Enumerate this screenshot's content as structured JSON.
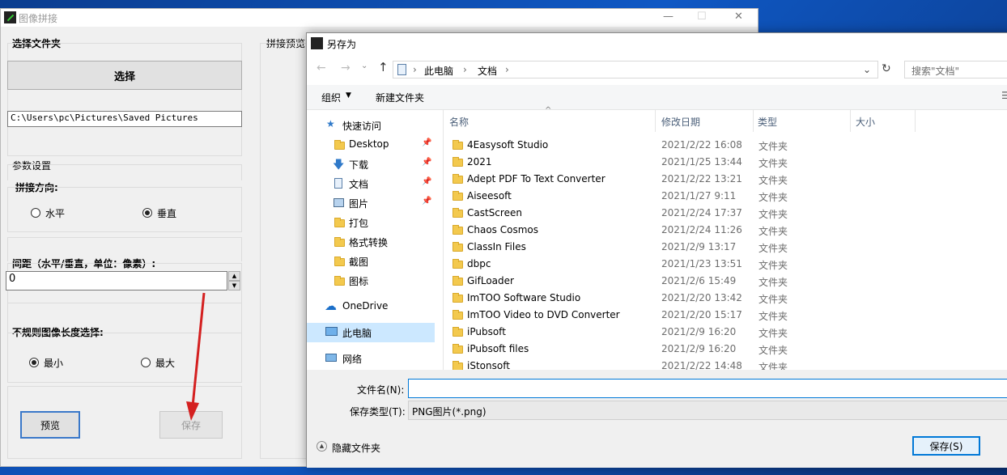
{
  "app": {
    "title": "图像拼接",
    "window_controls": {
      "minimize": "—",
      "maximize": "☐",
      "close": "✕"
    },
    "folder_label": "选择文件夹",
    "select_button": "选择",
    "path_value": "C:\\Users\\pc\\Pictures\\Saved Pictures",
    "params_label": "参数设置",
    "direction_label": "拼接方向:",
    "direction_options": [
      {
        "label": "水平",
        "checked": false
      },
      {
        "label": "垂直",
        "checked": true
      }
    ],
    "spacing_label": "间距（水平/垂直，单位：像素）:",
    "spacing_value": "0",
    "irregular_label": "不规则图像长度选择:",
    "irregular_options": [
      {
        "label": "最小",
        "checked": true
      },
      {
        "label": "最大",
        "checked": false
      }
    ],
    "preview_button": "预览",
    "save_button": "保存",
    "preview_area_label": "拼接预览"
  },
  "dialog": {
    "title": "另存为",
    "breadcrumb": [
      "此电脑",
      "文档"
    ],
    "search_placeholder": "搜索\"文档\"",
    "toolbar": {
      "organize": "组织",
      "new_folder": "新建文件夹"
    },
    "nav": [
      {
        "label": "快速访问",
        "icon": "star-icon",
        "pinned": false
      },
      {
        "label": "Desktop",
        "icon": "folder-icon",
        "pinned": true
      },
      {
        "label": "下载",
        "icon": "download-icon",
        "pinned": true
      },
      {
        "label": "文档",
        "icon": "document-icon",
        "pinned": true
      },
      {
        "label": "图片",
        "icon": "picture-icon",
        "pinned": true
      },
      {
        "label": "打包",
        "icon": "folder-icon",
        "pinned": false
      },
      {
        "label": "格式转换",
        "icon": "folder-icon",
        "pinned": false
      },
      {
        "label": "截图",
        "icon": "folder-icon",
        "pinned": false
      },
      {
        "label": "图标",
        "icon": "folder-icon",
        "pinned": false
      },
      {
        "label": "OneDrive",
        "icon": "cloud-icon",
        "pinned": false
      },
      {
        "label": "此电脑",
        "icon": "computer-icon",
        "pinned": false,
        "selected": true
      },
      {
        "label": "网络",
        "icon": "network-icon",
        "pinned": false
      }
    ],
    "columns": [
      "名称",
      "修改日期",
      "类型",
      "大小"
    ],
    "files": [
      {
        "name": "4Easysoft Studio",
        "date": "2021/2/22 16:08",
        "type": "文件夹"
      },
      {
        "name": "2021",
        "date": "2021/1/25 13:44",
        "type": "文件夹"
      },
      {
        "name": "Adept PDF To Text Converter",
        "date": "2021/2/22 13:21",
        "type": "文件夹"
      },
      {
        "name": "Aiseesoft",
        "date": "2021/1/27 9:11",
        "type": "文件夹"
      },
      {
        "name": "CastScreen",
        "date": "2021/2/24 17:37",
        "type": "文件夹"
      },
      {
        "name": "Chaos Cosmos",
        "date": "2021/2/24 11:26",
        "type": "文件夹"
      },
      {
        "name": "ClassIn Files",
        "date": "2021/2/9 13:17",
        "type": "文件夹"
      },
      {
        "name": "dbpc",
        "date": "2021/1/23 13:51",
        "type": "文件夹"
      },
      {
        "name": "GifLoader",
        "date": "2021/2/6 15:49",
        "type": "文件夹"
      },
      {
        "name": "ImTOO Software Studio",
        "date": "2021/2/20 13:42",
        "type": "文件夹"
      },
      {
        "name": "ImTOO Video to DVD Converter",
        "date": "2021/2/20 15:17",
        "type": "文件夹"
      },
      {
        "name": "iPubsoft",
        "date": "2021/2/9 16:20",
        "type": "文件夹"
      },
      {
        "name": "iPubsoft files",
        "date": "2021/2/9 16:20",
        "type": "文件夹"
      },
      {
        "name": "iStonsoft",
        "date": "2021/2/22 14:48",
        "type": "文件夹"
      }
    ],
    "filename_label": "文件名(N):",
    "filename_value": "",
    "filetype_label": "保存类型(T):",
    "filetype_value": "PNG图片(*.png)",
    "hide_folders": "隐藏文件夹",
    "save_button": "保存(S)"
  },
  "colors": {
    "accent": "#0078d7",
    "arrow": "#d42020",
    "selected_nav": "#cce8ff"
  }
}
